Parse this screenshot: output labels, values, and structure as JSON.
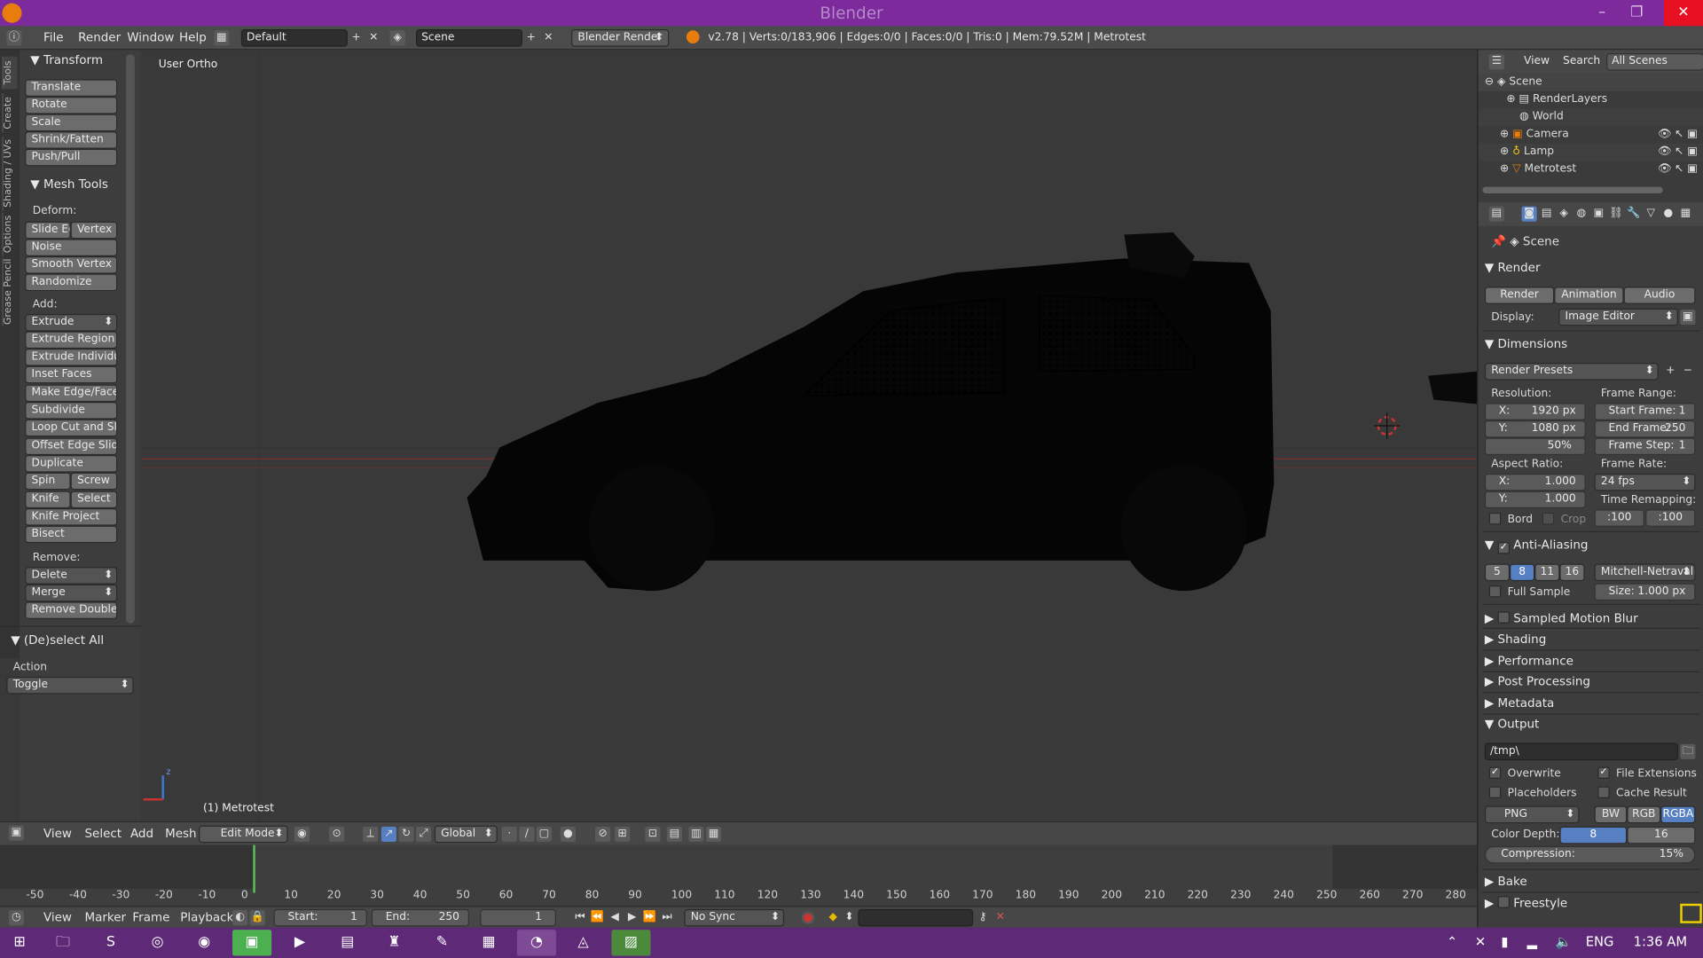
{
  "window": {
    "title": "Blender",
    "minimize": "–",
    "restore": "❐",
    "close": "✕"
  },
  "info_header": {
    "menus": [
      "File",
      "Render",
      "Window",
      "Help"
    ],
    "layout": "Default",
    "scene": "Scene",
    "engine": "Blender Render",
    "stats": "v2.78 | Verts:0/183,906 | Edges:0/0 | Faces:0/0 | Tris:0 | Mem:79.52M | Metrotest"
  },
  "toolshelf": {
    "tabs": [
      "Tools",
      "Create",
      "Shading / UVs",
      "Options",
      "Grease Pencil"
    ],
    "transform": {
      "title": "Transform",
      "buttons": [
        "Translate",
        "Rotate",
        "Scale",
        "Shrink/Fatten",
        "Push/Pull"
      ]
    },
    "mesh_tools": {
      "title": "Mesh Tools",
      "deform_label": "Deform:",
      "slide_edge": "Slide Ed",
      "vertex": "Vertex",
      "noise": "Noise",
      "smooth_vertex": "Smooth Vertex",
      "randomize": "Randomize",
      "add_label": "Add:",
      "extrude": "Extrude",
      "extrude_region": "Extrude Region",
      "extrude_individual": "Extrude Individual",
      "inset_faces": "Inset Faces",
      "make_edge_face": "Make Edge/Face",
      "subdivide": "Subdivide",
      "loop_cut": "Loop Cut and Slide",
      "offset_edge": "Offset Edge Slide",
      "duplicate": "Duplicate",
      "spin": "Spin",
      "screw": "Screw",
      "knife": "Knife",
      "select": "Select",
      "knife_project": "Knife Project",
      "bisect": "Bisect",
      "remove_label": "Remove:",
      "delete": "Delete",
      "merge": "Merge",
      "remove_doubles": "Remove Doubles"
    },
    "operator": {
      "title": "(De)select All",
      "action_label": "Action",
      "action_value": "Toggle"
    }
  },
  "viewport": {
    "view_name": "User Ortho",
    "object_label": "(1) Metrotest",
    "axis_z": "z"
  },
  "view3d_header": {
    "menus": [
      "View",
      "Select",
      "Add",
      "Mesh"
    ],
    "mode": "Edit Mode",
    "orientation": "Global"
  },
  "timeline": {
    "ticks": [
      "-50",
      "-40",
      "-30",
      "-20",
      "-10",
      "0",
      "10",
      "20",
      "30",
      "40",
      "50",
      "60",
      "70",
      "80",
      "90",
      "100",
      "110",
      "120",
      "130",
      "140",
      "150",
      "160",
      "170",
      "180",
      "190",
      "200",
      "210",
      "220",
      "230",
      "240",
      "250",
      "260",
      "270",
      "280"
    ],
    "menus": [
      "View",
      "Marker",
      "Frame",
      "Playback"
    ],
    "start_label": "Start:",
    "start": "1",
    "end_label": "End:",
    "end": "250",
    "current": "1",
    "sync": "No Sync"
  },
  "outliner": {
    "menus": [
      "View",
      "Search"
    ],
    "filter": "All Scenes",
    "items": [
      "Scene",
      "RenderLayers",
      "World",
      "Camera",
      "Lamp",
      "Metrotest"
    ]
  },
  "properties": {
    "context": "Scene",
    "render": {
      "title": "Render",
      "render_btn": "Render",
      "animation_btn": "Animation",
      "audio_btn": "Audio",
      "display_label": "Display:",
      "display_value": "Image Editor"
    },
    "dimensions": {
      "title": "Dimensions",
      "presets": "Render Presets",
      "resolution_label": "Resolution:",
      "res_x": "X:",
      "res_x_val": "1920 px",
      "res_y": "Y:",
      "res_y_val": "1080 px",
      "percent": "50%",
      "frame_range_label": "Frame Range:",
      "start_frame": "Start Frame:",
      "start_frame_val": "1",
      "end_frame": "End Frame:",
      "end_frame_val": "250",
      "frame_step": "Frame Step:",
      "frame_step_val": "1",
      "aspect_label": "Aspect Ratio:",
      "asp_x": "X:",
      "asp_x_val": "1.000",
      "asp_y": "Y:",
      "asp_y_val": "1.000",
      "frame_rate_label": "Frame Rate:",
      "frame_rate": "24 fps",
      "time_remap_label": "Time Remapping:",
      "remap_old": ":100",
      "remap_new": ":100",
      "bord": "Bord",
      "crop": "Crop"
    },
    "anti_aliasing": {
      "title": "Anti-Aliasing",
      "samples": [
        "5",
        "8",
        "11",
        "16"
      ],
      "selected": "8",
      "filter": "Mitchell-Netravali",
      "full_sample": "Full Sample",
      "size_label": "Size:",
      "size_val": "1.000 px"
    },
    "collapsed": [
      "Sampled Motion Blur",
      "Shading",
      "Performance",
      "Post Processing",
      "Metadata"
    ],
    "output": {
      "title": "Output",
      "path": "/tmp\\",
      "overwrite": "Overwrite",
      "file_ext": "File Extensions",
      "placeholders": "Placeholders",
      "cache_result": "Cache Result",
      "format": "PNG",
      "bw": "BW",
      "rgb": "RGB",
      "rgba": "RGBA",
      "color_depth_label": "Color Depth:",
      "depth_8": "8",
      "depth_16": "16",
      "compression_label": "Compression:",
      "compression": "15%"
    },
    "bottom": [
      "Bake",
      "Freestyle"
    ]
  },
  "taskbar": {
    "lang": "ENG",
    "time": "1:36 AM"
  }
}
